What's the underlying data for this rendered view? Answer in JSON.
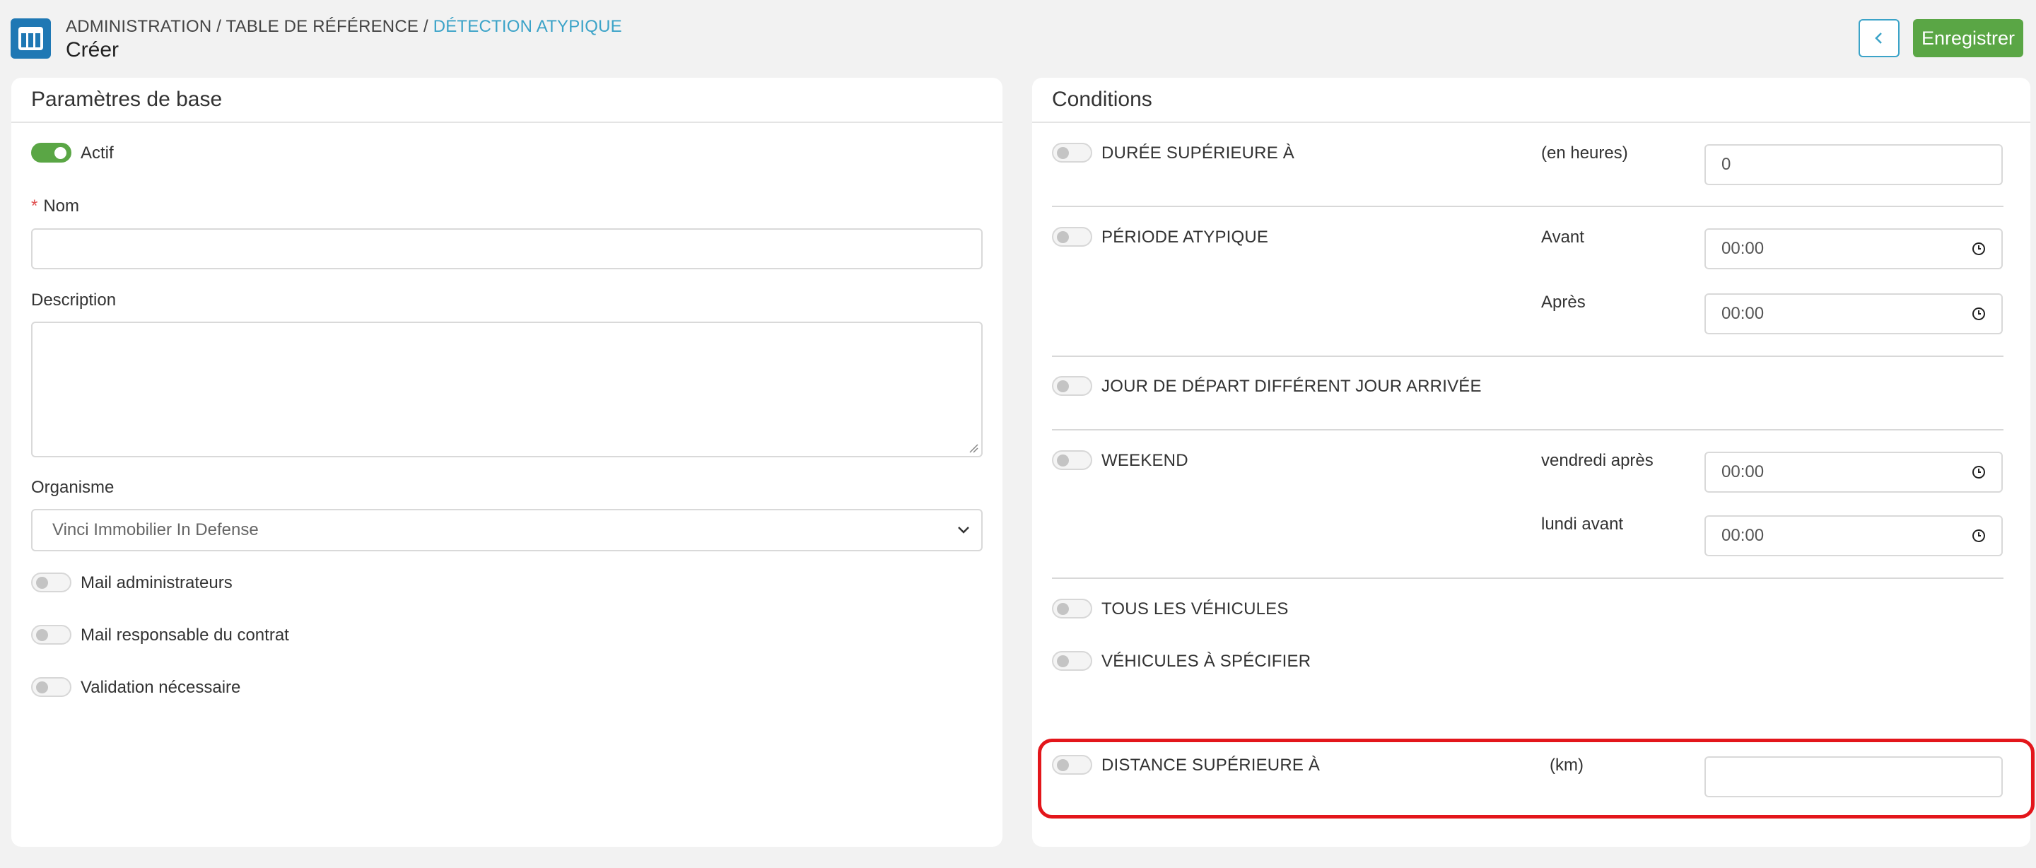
{
  "header": {
    "breadcrumb": {
      "part1": "ADMINISTRATION",
      "sep": " / ",
      "part2": "TABLE DE RÉFÉRENCE",
      "part3": "DÉTECTION ATYPIQUE"
    },
    "title": "Créer",
    "back_icon": "chevron-left-icon",
    "save_label": "Enregistrer"
  },
  "left_panel": {
    "title": "Paramètres de base",
    "actif_label": "Actif",
    "actif_on": true,
    "nom_label": "Nom",
    "nom_required": "*",
    "nom_value": "",
    "description_label": "Description",
    "description_value": "",
    "organisme_label": "Organisme",
    "organisme_selected": "Vinci Immobilier In Defense",
    "mail_admin_label": "Mail administrateurs",
    "mail_contract_label": "Mail responsable du contrat",
    "validation_label": "Validation nécessaire"
  },
  "right_panel": {
    "title": "Conditions",
    "duree": {
      "label": "DURÉE SUPÉRIEURE À",
      "unit": "(en heures)",
      "value": "0"
    },
    "periode": {
      "label": "PÉRIODE ATYPIQUE",
      "avant_label": "Avant",
      "avant_value": "00:00",
      "apres_label": "Après",
      "apres_value": "00:00"
    },
    "jour_depart": {
      "label": "JOUR DE DÉPART DIFFÉRENT JOUR ARRIVÉE"
    },
    "weekend": {
      "label": "WEEKEND",
      "vendredi_label": "vendredi après",
      "vendredi_value": "00:00",
      "lundi_label": "lundi avant",
      "lundi_value": "00:00"
    },
    "tous_vehicules": {
      "label": "TOUS LES VÉHICULES"
    },
    "vehicules_specifier": {
      "label": "VÉHICULES À SPÉCIFIER"
    },
    "distance": {
      "label": "DISTANCE SUPÉRIEURE À",
      "unit": "(km)",
      "value": ""
    }
  },
  "colors": {
    "accent": "#3ba3c8",
    "primary_button": "#5aa645",
    "app_icon": "#1f78b4",
    "highlight": "#e3161b"
  }
}
